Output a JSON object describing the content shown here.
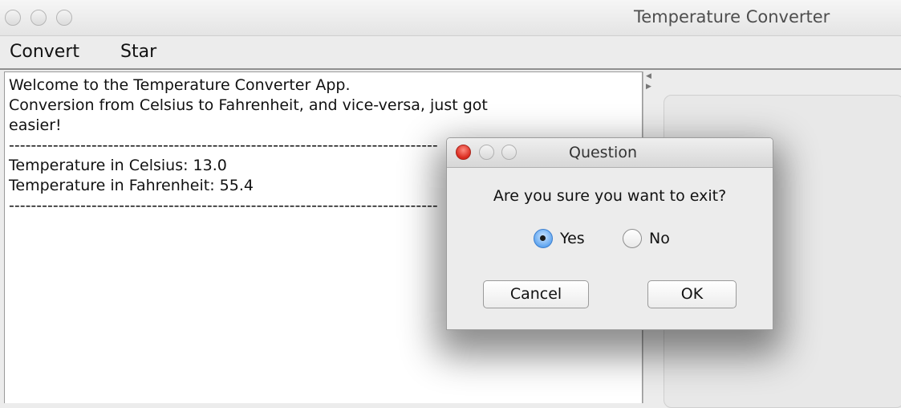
{
  "window": {
    "title": "Temperature Converter"
  },
  "menubar": {
    "items": [
      "Convert",
      "Star"
    ]
  },
  "output": {
    "lines": [
      "Welcome to the Temperature Converter App.",
      "Conversion from Celsius to Fahrenheit, and vice-versa, just got",
      "easier!",
      "------------------------------------------------------------------------------",
      "Temperature in Celsius: 13.0",
      "Temperature in Fahrenheit: 55.4",
      "------------------------------------------------------------------------------"
    ]
  },
  "dialog": {
    "title": "Question",
    "message": "Are you sure you want to exit?",
    "options": {
      "yes": "Yes",
      "no": "No",
      "selected": "Yes"
    },
    "cancel_label": "Cancel",
    "ok_label": "OK"
  },
  "colors": {
    "close_button": "#d9281d",
    "selected_radio": "#5aa2ef"
  },
  "icons": {
    "close": "close-icon",
    "minimize": "minimize-icon",
    "maximize": "maximize-icon",
    "splitter": "splitter-arrow-icon"
  }
}
